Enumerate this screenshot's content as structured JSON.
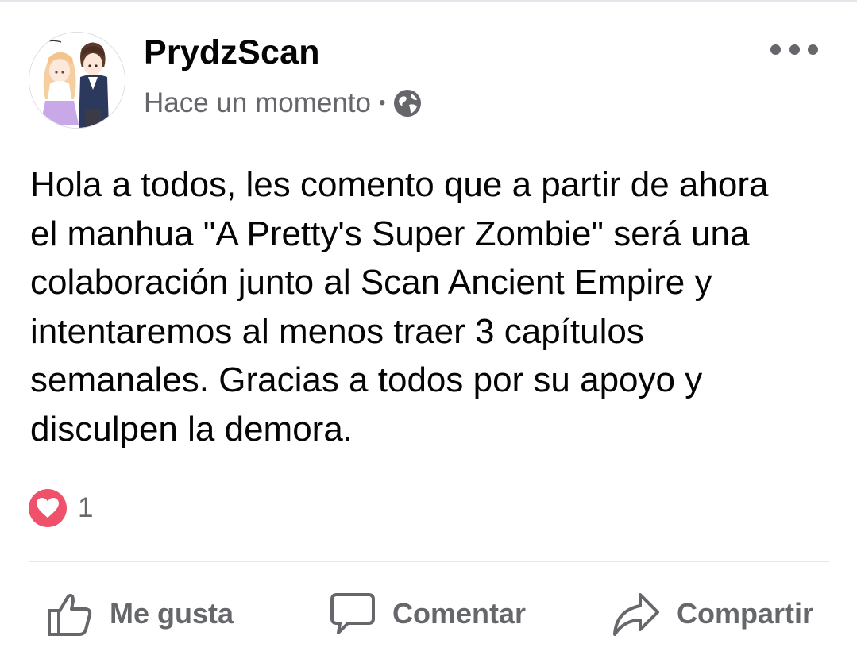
{
  "post": {
    "author": "PrydzScan",
    "timestamp": "Hace un momento",
    "separator": "•",
    "privacy_icon": "globe-icon",
    "text": "Hola a todos, les comento que a partir de ahora\nel manhua \"A Pretty's Super Zombie\" será una\ncolaboración junto al Scan Ancient Empire y\nintentaremos al menos traer 3 capítulos\nsemanales. Gracias a todos por su apoyo y\ndisculpen la demora."
  },
  "reactions": {
    "icon": "heart-icon",
    "count": "1",
    "color": "#f0516a"
  },
  "actions": {
    "like_label": "Me gusta",
    "comment_label": "Comentar",
    "share_label": "Compartir"
  },
  "colors": {
    "text": "#050505",
    "muted": "#65676b",
    "divider": "#e4e6eb"
  }
}
